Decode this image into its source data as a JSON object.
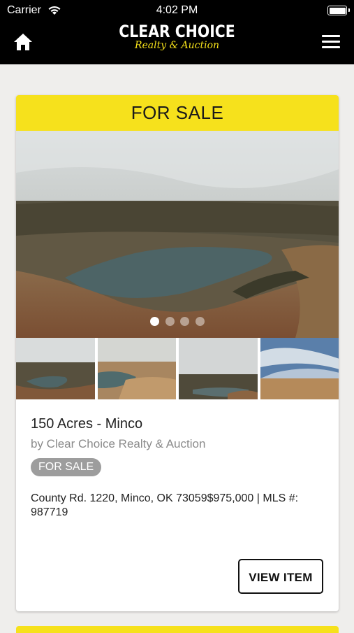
{
  "status_bar": {
    "carrier": "Carrier",
    "time": "4:02 PM"
  },
  "header": {
    "logo_main": "CLEAR CHOICE",
    "logo_sub": "Realty & Auction",
    "home_icon": "home-icon",
    "menu_icon": "hamburger-menu-icon"
  },
  "listing": {
    "banner": "FOR SALE",
    "title": "150 Acres - Minco",
    "byline": "by Clear Choice Realty & Auction",
    "badge": "FOR SALE",
    "description": "County Rd. 1220, Minco, OK 73059$975,000 | MLS #: 987719",
    "view_button": "VIEW ITEM",
    "carousel": {
      "total": 4,
      "active_index": 0
    },
    "thumbnail_count": 4
  },
  "colors": {
    "accent": "#f6e11c",
    "badge": "#9d9d9d",
    "header": "#000000"
  }
}
